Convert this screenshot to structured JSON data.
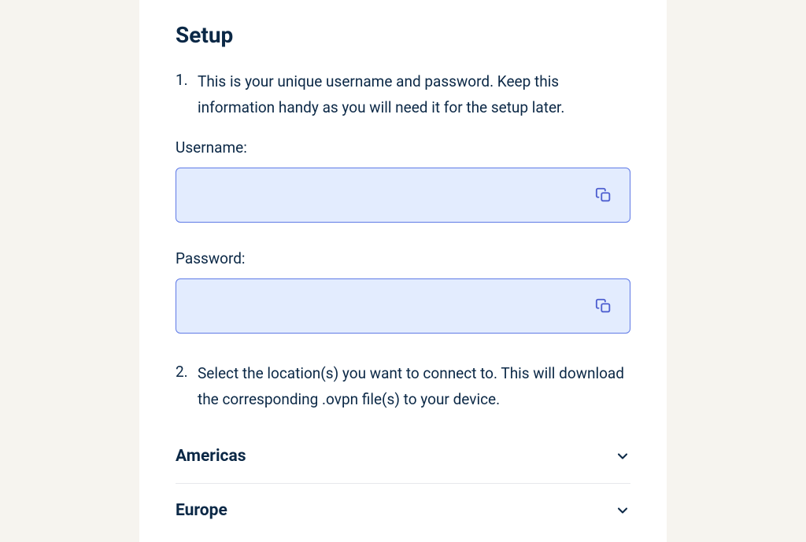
{
  "title": "Setup",
  "steps": {
    "s1": {
      "num": "1.",
      "text": "This is your unique username and password. Keep this information handy as you will need it for the setup later."
    },
    "s2": {
      "num": "2.",
      "text": "Select the location(s) you want to connect to. This will download the corresponding .ovpn file(s) to your device."
    }
  },
  "fields": {
    "username": {
      "label": "Username:",
      "value": ""
    },
    "password": {
      "label": "Password:",
      "value": ""
    }
  },
  "regions": {
    "r1": "Americas",
    "r2": "Europe"
  }
}
